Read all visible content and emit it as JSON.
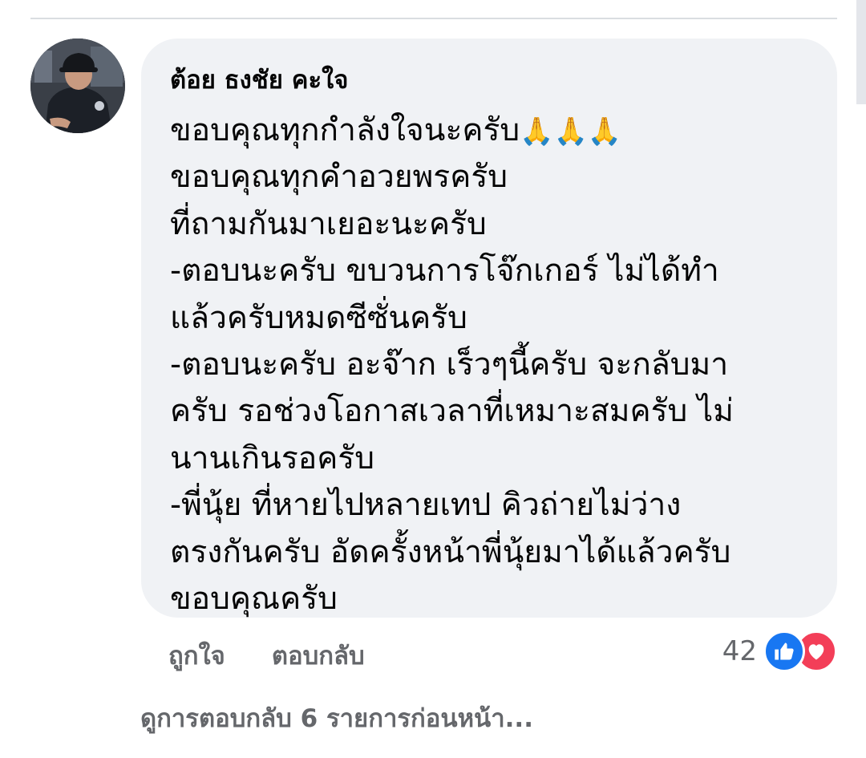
{
  "comment": {
    "author": "ต้อย ธงชัย คะใจ",
    "line1_text": "ขอบคุณทุกกำลังใจนะครับ",
    "line1_emoji": "🙏🙏🙏",
    "lines": [
      "ขอบคุณทุกคำอวยพรครับ",
      "ที่ถามกันมาเยอะนะครับ",
      "-ตอบนะครับ ขบวนการโจ๊กเกอร์ ไม่ได้ทำ",
      "แล้วครับหมดซีซั่นครับ",
      "-ตอบนะครับ อะจ๊าก เร็วๆนี้ครับ จะกลับมา",
      "ครับ รอช่วงโอกาสเวลาที่เหมาะสมครับ ไม่",
      "นานเกินรอครับ",
      "-พี่นุ้ย ที่หายไปหลายเทป คิวถ่ายไม่ว่าง",
      "ตรงกันครับ อัดครั้งหน้าพี่นุ้ยมาได้แล้วครับ",
      "ขอบคุณครับ"
    ]
  },
  "actions": {
    "like_label": "ถูกใจ",
    "reply_label": "ตอบกลับ"
  },
  "reactions": {
    "count": "42",
    "icons": [
      "like-icon",
      "love-icon"
    ],
    "like_color": "#1877f2",
    "love_color": "#f33e58"
  },
  "view_previous_replies": "ดูการตอบกลับ 6 รายการก่อนหน้า..."
}
